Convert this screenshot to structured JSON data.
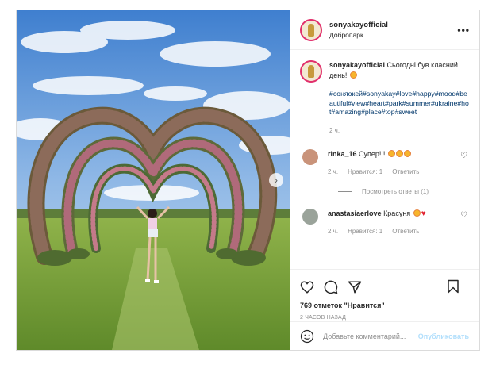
{
  "post": {
    "username": "sonyakayofficial",
    "location": "Добропарк",
    "more_icon": "•••",
    "next_icon": "›"
  },
  "caption": {
    "username": "sonyakayofficial",
    "text": "Сьогодні був класний день!",
    "hashtags": "#соняокей#sonyakay#love#happy#mood#beautiful#view#heart#park#summer#ukraine#hot#amazing#place#top#sweet",
    "time": "2 ч."
  },
  "comments": [
    {
      "username": "rinka_16",
      "text": "Супер!!!",
      "time": "2 ч.",
      "likes": "Нравится: 1",
      "reply": "Ответить"
    },
    {
      "username": "anastasiaerlove",
      "text": "Красуня",
      "time": "2 ч.",
      "likes": "Нравится: 1",
      "reply": "Ответить"
    }
  ],
  "view_replies": "Посмотреть ответы (1)",
  "actions": {
    "likes_text": "769 отметок \"Нравится\"",
    "post_time": "2 ЧАСОВ НАЗАД"
  },
  "add_comment": {
    "placeholder": "Добавьте комментарий...",
    "publish": "Опубликовать"
  }
}
